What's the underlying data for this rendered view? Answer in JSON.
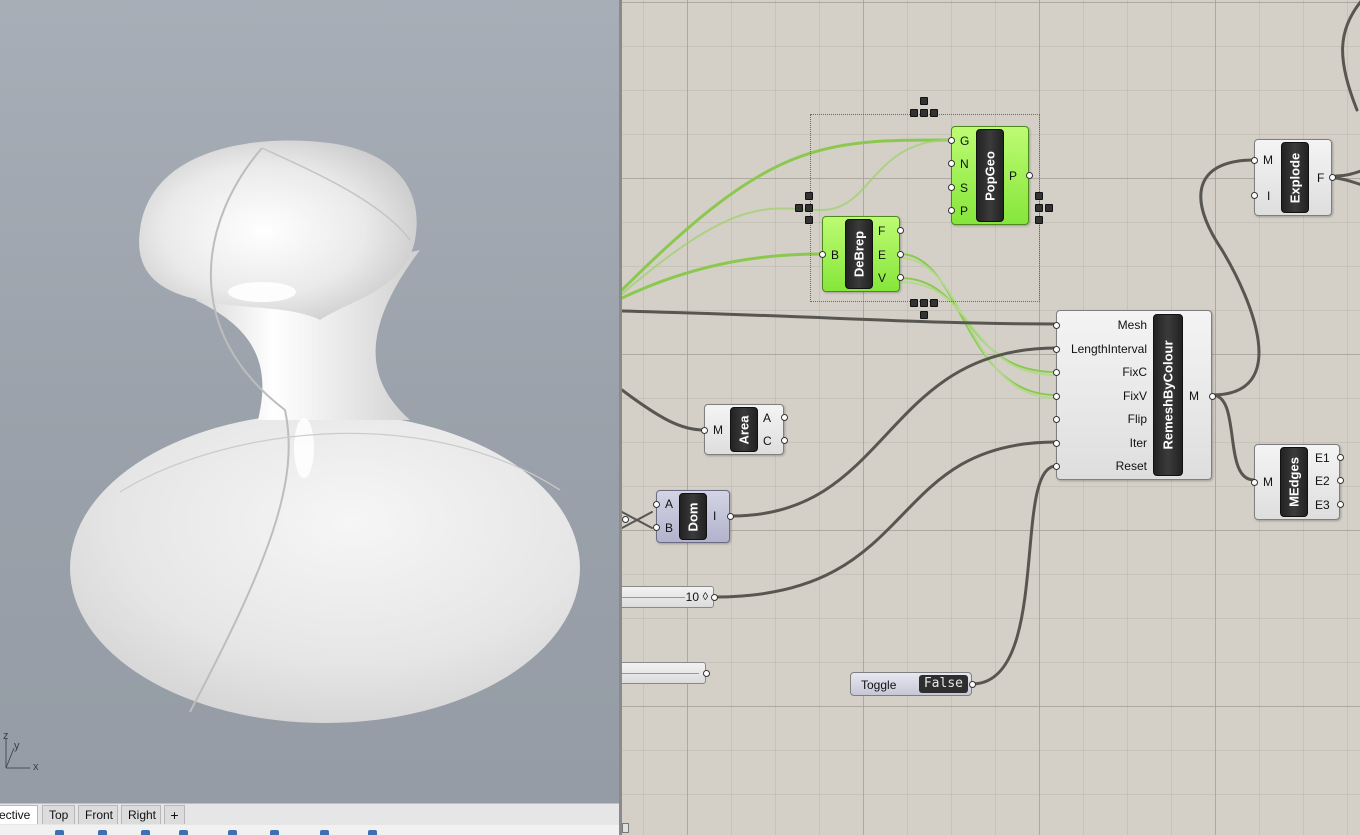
{
  "viewport": {
    "tabs": [
      {
        "label": "ective",
        "active": true
      },
      {
        "label": "Top",
        "active": false
      },
      {
        "label": "Front",
        "active": false
      },
      {
        "label": "Right",
        "active": false
      }
    ],
    "add_tab_icon": "plus-icon",
    "axes": {
      "z": "z",
      "y": "y",
      "x": "x"
    }
  },
  "canvas": {
    "components": {
      "popgeo": {
        "name": "PopGeo",
        "inputs": [
          "G",
          "N",
          "S",
          "P"
        ],
        "outputs": [
          "P"
        ]
      },
      "debrep": {
        "name": "DeBrep",
        "inputs": [
          "B"
        ],
        "outputs": [
          "F",
          "E",
          "V"
        ]
      },
      "explode": {
        "name": "Explode",
        "inputs": [
          "M",
          "I"
        ],
        "outputs": [
          "F"
        ]
      },
      "remesh": {
        "name": "RemeshByColour",
        "inputs": [
          "Mesh",
          "LengthInterval",
          "FixC",
          "FixV",
          "Flip",
          "Iter",
          "Reset"
        ],
        "outputs": [
          "M"
        ]
      },
      "area": {
        "name": "Area",
        "inputs": [
          "M"
        ],
        "outputs": [
          "A",
          "C"
        ]
      },
      "dom": {
        "name": "Dom",
        "inputs": [
          "A",
          "B"
        ],
        "outputs": [
          "I"
        ]
      },
      "medges": {
        "name": "MEdges",
        "inputs": [
          "M"
        ],
        "outputs": [
          "E1",
          "E2",
          "E3"
        ]
      }
    },
    "slider": {
      "value": "10",
      "knob": "◊"
    },
    "toggle": {
      "label": "Toggle",
      "value": "False"
    }
  },
  "colors": {
    "wire_default": "#585650",
    "wire_selected": "#8cc850",
    "component_selected": "#8fe83f"
  }
}
